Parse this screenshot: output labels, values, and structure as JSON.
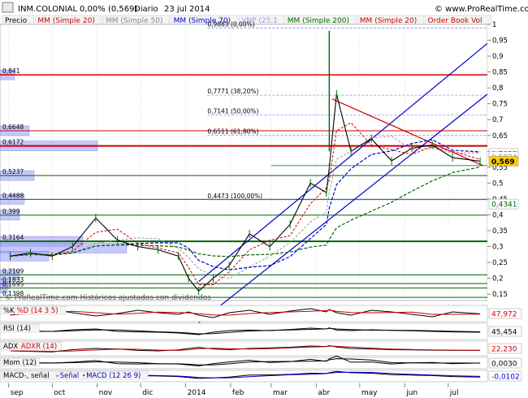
{
  "header": {
    "ticker": "INM.COLONIAL",
    "change": "0,00% (0,569)",
    "period": "Diario",
    "date": "23 jul 2014",
    "brand": "© www.ProRealTime.com"
  },
  "legend": [
    {
      "label": "Precio",
      "color": "#000000"
    },
    {
      "label": "MM (Simple 20)",
      "color": "#cc0000"
    },
    {
      "label": "MM (Simple 50)",
      "color": "#888888"
    },
    {
      "label": "MM (Simple 70)",
      "color": "#0000cc"
    },
    {
      "label": "VNP (25,1",
      "color": "#9999ff"
    },
    {
      "label": "MM (Simple 200)",
      "color": "#006600"
    },
    {
      "label": "MM (Simple 20)",
      "color": "#cc0000"
    },
    {
      "label": "Order Book Vol",
      "color": "#cc0000"
    }
  ],
  "watermark": "© ProRealTime.com   Históricos ajustados con dividendos",
  "price_axis": {
    "ticks": [
      "1",
      "0,95",
      "0,9",
      "0,85",
      "0,8",
      "0,75",
      "0,7",
      "0,65",
      "0,6",
      "0,55",
      "0,5",
      "0,45",
      "0,4",
      "0,35",
      "0,3",
      "0,25",
      "0,2",
      "0,15"
    ],
    "current": "0,569",
    "tag_0434": "0,4341",
    "tag_0593": "0,5933",
    "tag_0583": "0,5834"
  },
  "colors": {
    "price": "#000000",
    "sma20": "#cc0000",
    "sma50": "#999999",
    "sma70": "#0000cc",
    "sma200": "#006600",
    "channel": "#0000cc",
    "resistance": "#cc0000",
    "support": "#006600",
    "fib": "#8888ff",
    "volume_profile": "#9999ff"
  },
  "horizontal_levels": [
    {
      "value": 0.841,
      "label": "0,841",
      "color": "#cc0000",
      "width": 1.5
    },
    {
      "value": 0.6648,
      "label": "0,6648",
      "color": "#cc0000",
      "width": 1
    },
    {
      "value": 0.6172,
      "label": "0,6172",
      "color": "#cc0000",
      "width": 2
    },
    {
      "value": 0.5237,
      "label": "0,5237",
      "color": "#006600",
      "width": 1
    },
    {
      "value": 0.4488,
      "label": "0,4488",
      "color": "#006600",
      "width": 1
    },
    {
      "value": 0.399,
      "label": "0,399",
      "color": "#006600",
      "width": 1
    },
    {
      "value": 0.3164,
      "label": "0,3164",
      "color": "#006600",
      "width": 2
    },
    {
      "value": 0.2109,
      "label": "0,2109",
      "color": "#006600",
      "width": 1
    },
    {
      "value": 0.1833,
      "label": "0,1833",
      "color": "#006600",
      "width": 1
    },
    {
      "value": 0.1695,
      "label": "0,1695",
      "color": "#006600",
      "width": 1
    },
    {
      "value": 0.1398,
      "label": "0,1398",
      "color": "#006600",
      "width": 1
    }
  ],
  "fib_levels": [
    {
      "value": 0.9883,
      "label": "0,9883 (0,00%)"
    },
    {
      "value": 0.7771,
      "label": "0,7771 (38,20%)"
    },
    {
      "value": 0.7141,
      "label": "0,7141 (50,00%)"
    },
    {
      "value": 0.6511,
      "label": "0,6511 (61,80%)"
    },
    {
      "value": 0.4473,
      "label": "0,4473 (100,00%)"
    }
  ],
  "volume_profile": [
    {
      "price": 0.841,
      "size": 0.03
    },
    {
      "price": 0.6648,
      "size": 0.06
    },
    {
      "price": 0.6172,
      "size": 0.2
    },
    {
      "price": 0.5237,
      "size": 0.07
    },
    {
      "price": 0.4488,
      "size": 0.05
    },
    {
      "price": 0.399,
      "size": 0.04
    },
    {
      "price": 0.3164,
      "size": 0.17
    },
    {
      "price": 0.295,
      "size": 0.26
    },
    {
      "price": 0.27,
      "size": 0.1
    },
    {
      "price": 0.2109,
      "size": 0.04
    },
    {
      "price": 0.1833,
      "size": 0.02
    },
    {
      "price": 0.1695,
      "size": 0.015
    }
  ],
  "chart_data": {
    "type": "line",
    "ylim": [
      0.13,
      1.0
    ],
    "x": [
      "2013-09-02",
      "2013-09-16",
      "2013-10-01",
      "2013-10-15",
      "2013-10-31",
      "2013-11-15",
      "2013-11-29",
      "2013-12-13",
      "2013-12-27",
      "2014-01-03",
      "2014-01-10",
      "2014-01-20",
      "2014-01-31",
      "2014-02-14",
      "2014-02-28",
      "2014-03-14",
      "2014-03-28",
      "2014-04-08",
      "2014-04-10",
      "2014-04-15",
      "2014-04-25",
      "2014-05-09",
      "2014-05-23",
      "2014-06-06",
      "2014-06-20",
      "2014-07-04",
      "2014-07-23"
    ],
    "series": [
      {
        "values": [
          0.27,
          0.28,
          0.27,
          0.3,
          0.39,
          0.32,
          0.3,
          0.29,
          0.27,
          0.2,
          0.16,
          0.2,
          0.24,
          0.34,
          0.3,
          0.37,
          0.5,
          0.47,
          0.55,
          0.78,
          0.6,
          0.64,
          0.57,
          0.61,
          0.62,
          0.58,
          0.569
        ]
      }
    ],
    "xlabels": [
      "sep",
      "oct",
      "nov",
      "dic",
      "2014",
      "feb",
      "mar",
      "abr",
      "may",
      "jun",
      "jul"
    ]
  },
  "indicators": [
    {
      "name": "%K",
      "label": "%D (14 3 5)",
      "value": "47,972",
      "range": [
        0,
        100
      ],
      "color": "#cc0000",
      "values": [
        40,
        60,
        75,
        55,
        35,
        50,
        70,
        55,
        45,
        60,
        40,
        25,
        55,
        70,
        45,
        65,
        80,
        60,
        75,
        55,
        40,
        70,
        60,
        45,
        30,
        60,
        48
      ]
    },
    {
      "name": "RSI (14)",
      "label": "",
      "value": "45,454",
      "range": [
        0,
        100
      ],
      "color": "#000000",
      "values": [
        48,
        52,
        50,
        60,
        65,
        50,
        47,
        45,
        40,
        35,
        30,
        45,
        55,
        58,
        55,
        62,
        70,
        65,
        72,
        58,
        55,
        60,
        56,
        54,
        50,
        47,
        45
      ]
    },
    {
      "name": "ADX",
      "label": "ADXR (14)",
      "value": "22,230",
      "range": [
        0,
        60
      ],
      "color": "#cc0000",
      "values": [
        20,
        18,
        16,
        25,
        30,
        28,
        22,
        20,
        24,
        30,
        34,
        28,
        25,
        30,
        32,
        35,
        40,
        38,
        42,
        36,
        30,
        28,
        25,
        24,
        23,
        22,
        22
      ]
    },
    {
      "name": "Mom (12)",
      "label": "",
      "value": "0,0030",
      "range": [
        -0.2,
        0.2
      ],
      "color": "#000000",
      "values": [
        0,
        0.01,
        0,
        0.03,
        0.09,
        -0.02,
        -0.03,
        -0.02,
        -0.03,
        -0.07,
        -0.1,
        -0.02,
        0.04,
        0.1,
        0.02,
        0.05,
        0.13,
        0.06,
        0.15,
        0.25,
        0.03,
        0.04,
        -0.03,
        0.01,
        0.02,
        -0.02,
        0.003
      ]
    },
    {
      "name": "MACD-, señal",
      "label": "Señal",
      "label2": "MACD (12 26 9)",
      "value": "-0,0102",
      "range": [
        -0.06,
        0.06
      ],
      "color": "#0000cc",
      "values": [
        0,
        0.002,
        0.001,
        0.005,
        0.015,
        0.01,
        0.004,
        0.001,
        -0.005,
        -0.015,
        -0.025,
        -0.02,
        -0.01,
        0.01,
        0.012,
        0.018,
        0.03,
        0.028,
        0.035,
        0.05,
        0.035,
        0.03,
        0.015,
        0.01,
        0.005,
        -0.005,
        -0.0102
      ]
    }
  ]
}
